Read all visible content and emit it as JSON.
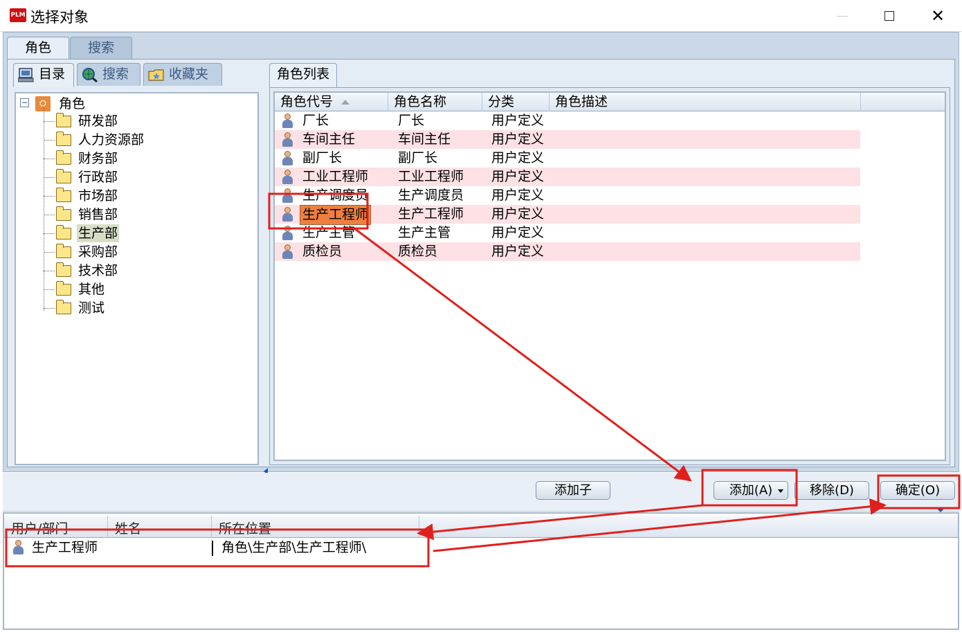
{
  "window": {
    "title": "选择对象",
    "app_icon_text": "PLM",
    "minimize_icon": "minimize-icon",
    "maximize_icon": "maximize-icon",
    "close_icon": "close-icon",
    "close_glyph": "✕"
  },
  "outer_tabs": [
    {
      "label": "角色",
      "active": true
    },
    {
      "label": "搜索",
      "active": false
    }
  ],
  "inner_tabs": [
    {
      "label": "目录",
      "icon": "computer-icon",
      "active": true
    },
    {
      "label": "搜索",
      "icon": "globe-search-icon",
      "active": false
    },
    {
      "label": "收藏夹",
      "icon": "favorites-folder-icon",
      "active": false
    }
  ],
  "tree": {
    "root": {
      "label": "角色",
      "expand_glyph": "−",
      "icon_glyph": "⛭"
    },
    "items": [
      {
        "label": "研发部",
        "selected": false
      },
      {
        "label": "人力资源部",
        "selected": false
      },
      {
        "label": "财务部",
        "selected": false
      },
      {
        "label": "行政部",
        "selected": false
      },
      {
        "label": "市场部",
        "selected": false
      },
      {
        "label": "销售部",
        "selected": false
      },
      {
        "label": "生产部",
        "selected": true
      },
      {
        "label": "采购部",
        "selected": false
      },
      {
        "label": "技术部",
        "selected": false
      },
      {
        "label": "其他",
        "selected": false
      },
      {
        "label": "测试",
        "selected": false
      }
    ]
  },
  "role_list": {
    "tab_label": "角色列表",
    "columns": [
      "角色代号",
      "角色名称",
      "分类",
      "角色描述"
    ],
    "rows": [
      {
        "code": "厂长",
        "name": "厂长",
        "category": "用户定义",
        "desc": ""
      },
      {
        "code": "车间主任",
        "name": "车间主任",
        "category": "用户定义",
        "desc": ""
      },
      {
        "code": "副厂长",
        "name": "副厂长",
        "category": "用户定义",
        "desc": ""
      },
      {
        "code": "工业工程师",
        "name": "工业工程师",
        "category": "用户定义",
        "desc": ""
      },
      {
        "code": "生产调度员",
        "name": "生产调度员",
        "category": "用户定义",
        "desc": ""
      },
      {
        "code": "生产工程师",
        "name": "生产工程师",
        "category": "用户定义",
        "desc": ""
      },
      {
        "code": "生产主管",
        "name": "生产主管",
        "category": "用户定义",
        "desc": ""
      },
      {
        "code": "质检员",
        "name": "质检员",
        "category": "用户定义",
        "desc": ""
      }
    ],
    "selected_index": 5
  },
  "buttons": {
    "add_child": "添加子",
    "add": "添加(A)",
    "remove": "移除(D)",
    "ok": "确定(O)"
  },
  "selected_table": {
    "columns": [
      "用户/部门",
      "姓名",
      "所在位置"
    ],
    "rows": [
      {
        "user": "生产工程师",
        "name": "",
        "location": "角色\\生产部\\生产工程师\\"
      }
    ]
  },
  "colors": {
    "annotation_red": "#e0201c",
    "row_alt": "#fde1e4",
    "selection_orange": "#ef7f3c",
    "panel_blue": "#cad8e7"
  }
}
